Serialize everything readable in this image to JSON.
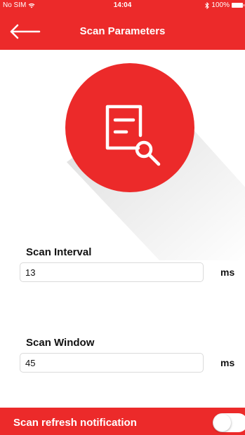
{
  "status_bar": {
    "carrier": "No SIM",
    "time": "14:04",
    "battery": "100%",
    "wifi_icon": "wifi-icon",
    "bluetooth_icon": "bluetooth-icon"
  },
  "header": {
    "title": "Scan Parameters",
    "back_icon": "arrow-left-icon"
  },
  "hero": {
    "icon": "document-search-icon",
    "circle_color": "#ec2a2a"
  },
  "fields": {
    "scan_interval": {
      "label": "Scan Interval",
      "value": "13",
      "unit": "ms"
    },
    "scan_window": {
      "label": "Scan Window",
      "value": "45",
      "unit": "ms"
    }
  },
  "footer": {
    "label": "Scan refresh notification",
    "toggle_on": false
  },
  "colors": {
    "accent": "#ec2a2a",
    "text": "#111111",
    "background": "#ffffff"
  }
}
